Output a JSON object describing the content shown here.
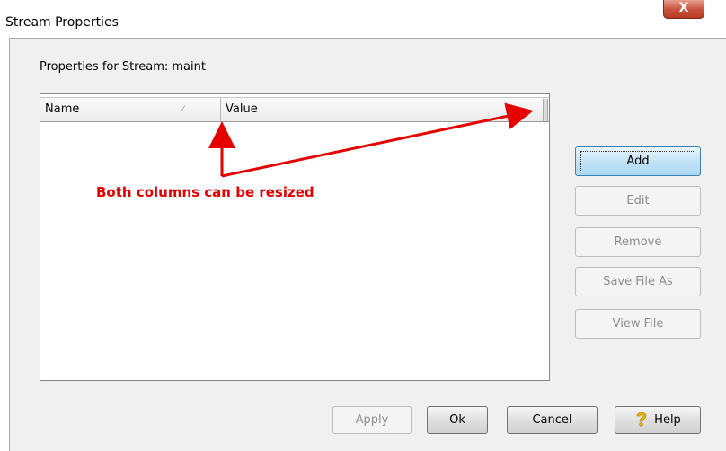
{
  "window": {
    "title": "Stream Properties",
    "close_glyph": "X"
  },
  "properties_label": "Properties for Stream: maint",
  "grid": {
    "columns": [
      {
        "label": "Name"
      },
      {
        "label": "Value"
      }
    ],
    "sort_glyph": "⁄",
    "rows": []
  },
  "annotation": {
    "text": "Both columns can be resized",
    "color": "#e60000"
  },
  "side_buttons": [
    {
      "label": "Add",
      "enabled": true
    },
    {
      "label": "Edit",
      "enabled": false
    },
    {
      "label": "Remove",
      "enabled": false
    },
    {
      "label": "Save File As",
      "enabled": false
    },
    {
      "label": "View File",
      "enabled": false
    }
  ],
  "bottom_buttons": {
    "apply": "Apply",
    "ok": "Ok",
    "cancel": "Cancel",
    "help": "Help",
    "help_icon": "question-mark-icon"
  }
}
